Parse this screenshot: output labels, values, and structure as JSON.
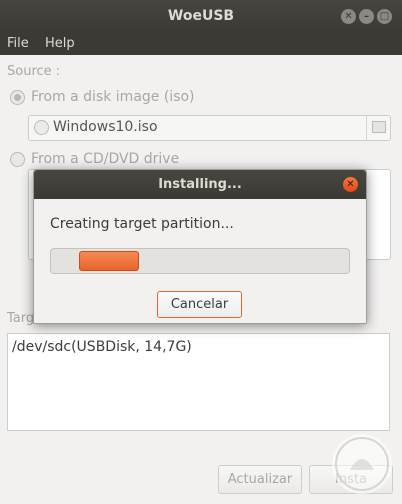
{
  "window": {
    "title": "WoeUSB"
  },
  "menu": {
    "file": "File",
    "help": "Help"
  },
  "source": {
    "label": "Source :",
    "disk_image_label": "From a disk image (iso)",
    "iso_file": "Windows10.iso",
    "cd_dvd_label": "From a CD/DVD drive"
  },
  "target": {
    "label": "Targ",
    "device": "/dev/sdc(USBDisk, 14,7G)"
  },
  "buttons": {
    "refresh": "Actualizar",
    "install": "Insta"
  },
  "dialog": {
    "title": "Installing...",
    "status": "Creating target partition...",
    "progress_fraction": 0.29,
    "cancel": "Cancelar"
  },
  "colors": {
    "accent": "#e9642b",
    "titlebar": "#3b3a35"
  }
}
